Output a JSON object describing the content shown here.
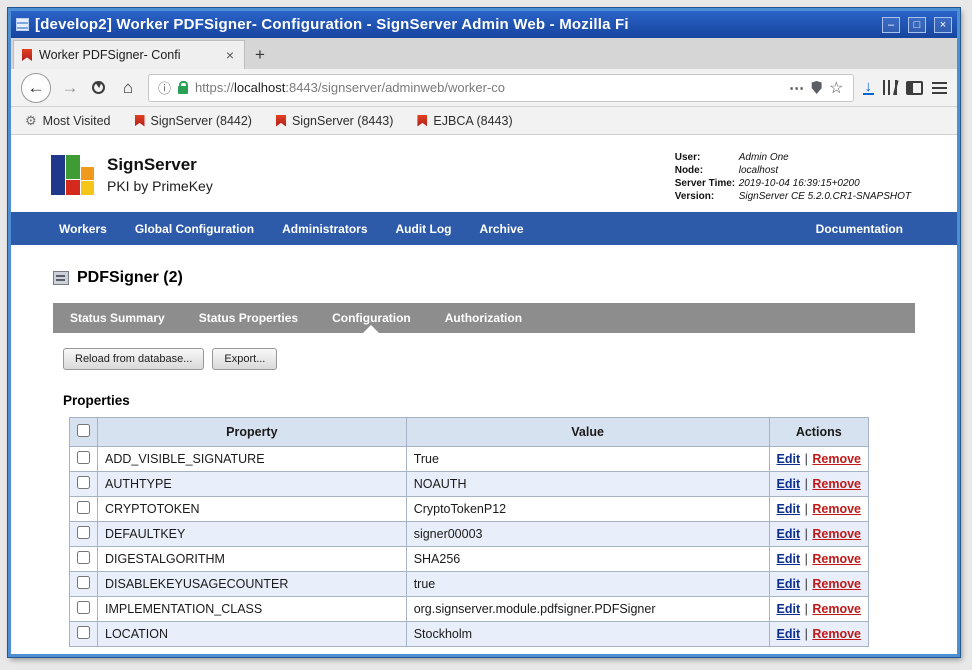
{
  "window": {
    "title": "[develop2] Worker PDFSigner- Configuration - SignServer Admin Web - Mozilla Fi",
    "controls": {
      "shade": "–",
      "maximize": "□",
      "close": "×"
    }
  },
  "icons": {
    "back": "←",
    "forward": "→",
    "home": "⌂",
    "info": "ⓘ",
    "more": "⋯",
    "star": "☆",
    "download": "↓",
    "new_tab": "+",
    "close_tab": "×",
    "gear": "⚙"
  },
  "browser": {
    "tab_title": "Worker PDFSigner- Confi",
    "url": {
      "scheme": "https://",
      "host": "localhost",
      "path": ":8443/signserver/adminweb/worker-co"
    },
    "bookmarks": [
      "Most Visited",
      "SignServer (8442)",
      "SignServer (8443)",
      "EJBCA (8443)"
    ]
  },
  "page": {
    "brand": {
      "title": "SignServer",
      "subtitle": "PKI by PrimeKey"
    },
    "session": [
      {
        "label": "User:",
        "value": "Admin One"
      },
      {
        "label": "Node:",
        "value": "localhost"
      },
      {
        "label": "Server Time:",
        "value": "2019-10-04 16:39:15+0200"
      },
      {
        "label": "Version:",
        "value": "SignServer CE 5.2.0.CR1-SNAPSHOT"
      }
    ],
    "nav": {
      "items": [
        "Workers",
        "Global Configuration",
        "Administrators",
        "Audit Log",
        "Archive"
      ],
      "right": "Documentation"
    },
    "title": "PDFSigner (2)",
    "tabs": [
      "Status Summary",
      "Status Properties",
      "Configuration",
      "Authorization"
    ],
    "buttons": {
      "reload": "Reload from database...",
      "export": "Export..."
    },
    "properties_heading": "Properties",
    "table": {
      "headers": {
        "property": "Property",
        "value": "Value",
        "actions": "Actions"
      },
      "edit_label": "Edit",
      "remove_label": "Remove",
      "separator": "|",
      "rows": [
        {
          "property": "ADD_VISIBLE_SIGNATURE",
          "value": "True"
        },
        {
          "property": "AUTHTYPE",
          "value": "NOAUTH"
        },
        {
          "property": "CRYPTOTOKEN",
          "value": "CryptoTokenP12"
        },
        {
          "property": "DEFAULTKEY",
          "value": "signer00003"
        },
        {
          "property": "DIGESTALGORITHM",
          "value": "SHA256"
        },
        {
          "property": "DISABLEKEYUSAGECOUNTER",
          "value": "true"
        },
        {
          "property": "IMPLEMENTATION_CLASS",
          "value": "org.signserver.module.pdfsigner.PDFSigner"
        },
        {
          "property": "LOCATION",
          "value": "Stockholm"
        }
      ]
    }
  }
}
